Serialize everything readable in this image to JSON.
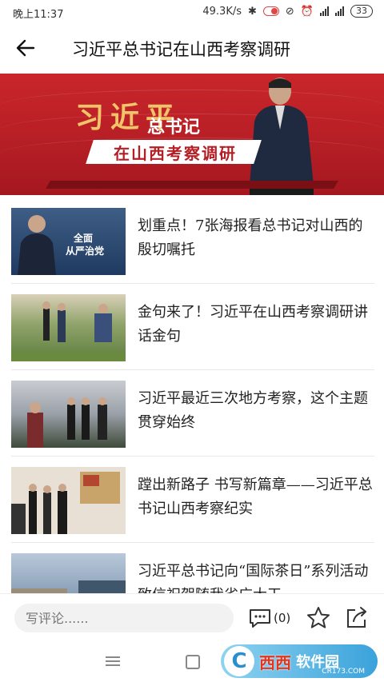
{
  "status_bar": {
    "time": "晚上11:37",
    "network_speed": "49.3K/s",
    "battery": "33"
  },
  "header": {
    "title": "习近平总书记在山西考察调研"
  },
  "banner": {
    "name": "习近平",
    "title_suffix": "总书记",
    "subtitle": "在山西考察调研"
  },
  "articles": [
    {
      "title": "划重点！7张海报看总书记对山西的殷切嘱托",
      "thumb_text": [
        "全面",
        "从严治党"
      ]
    },
    {
      "title": "金句来了！习近平在山西考察调研讲话金句"
    },
    {
      "title": "习近平最近三次地方考察，这个主题贯穿始终"
    },
    {
      "title": "蹚出新路子 书写新篇章——习近平总书记山西考察纪实"
    },
    {
      "title": "习近平总书记向“国际茶日”系列活动致信祝贺随我省广大干"
    }
  ],
  "bottom_bar": {
    "comment_placeholder": "写评论......",
    "comment_count": "(0)"
  },
  "watermark": {
    "logo": "C",
    "brand": "西西",
    "name": "软件园",
    "domain": "CR173.COM"
  },
  "colors": {
    "banner_red": "#b51e25",
    "gold": "#f2c46a"
  }
}
